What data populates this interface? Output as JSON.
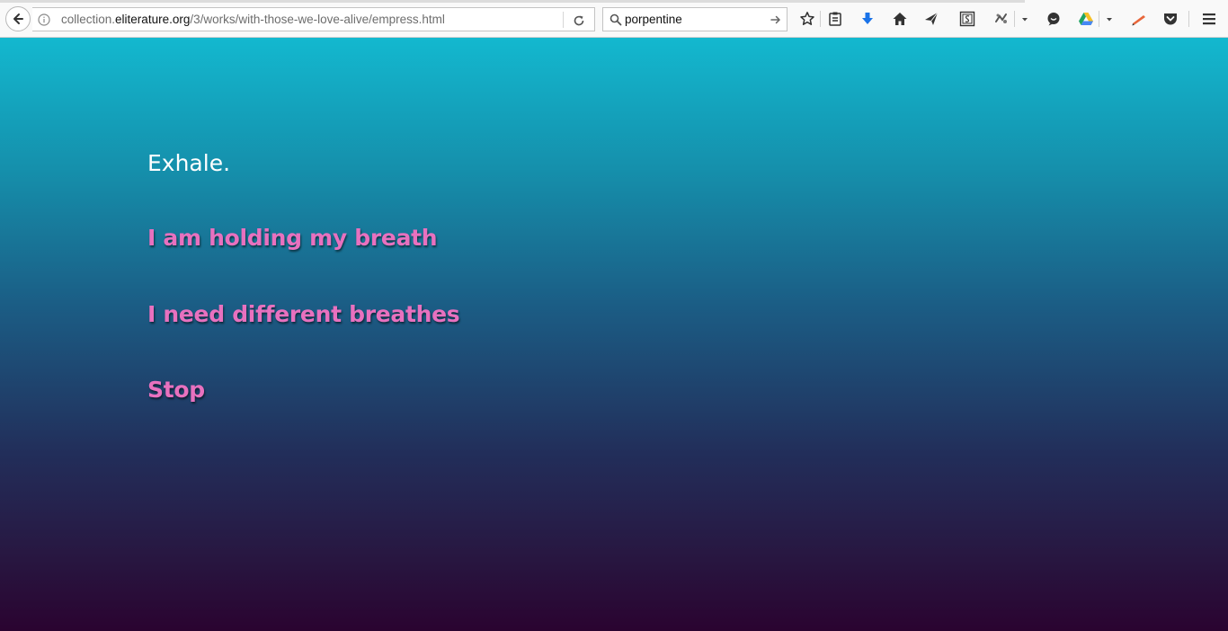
{
  "browser": {
    "url": {
      "prefix": "collection.",
      "domain": "eliterature.org",
      "path": "/3/works/with-those-we-love-alive/empress.html"
    },
    "search": {
      "value": "porpentine"
    },
    "toolbar_icons": [
      "bookmark-star-icon",
      "reading-list-icon",
      "download-icon",
      "home-icon",
      "send-icon",
      "screenshot-icon",
      "extension-icon",
      "chat-icon",
      "drive-icon",
      "pen-icon",
      "pocket-icon",
      "menu-icon"
    ],
    "colors": {
      "download": "#1a73e8",
      "pen": "#e8663a"
    }
  },
  "story": {
    "passage": "Exhale.",
    "choices": [
      "I am holding my breath",
      "I need different breathes",
      "Stop"
    ]
  },
  "colors": {
    "gradient_top": "#13b8cf",
    "gradient_bottom": "#2a0330",
    "choice_link": "#e871bf",
    "passage_text": "#ffffff"
  }
}
